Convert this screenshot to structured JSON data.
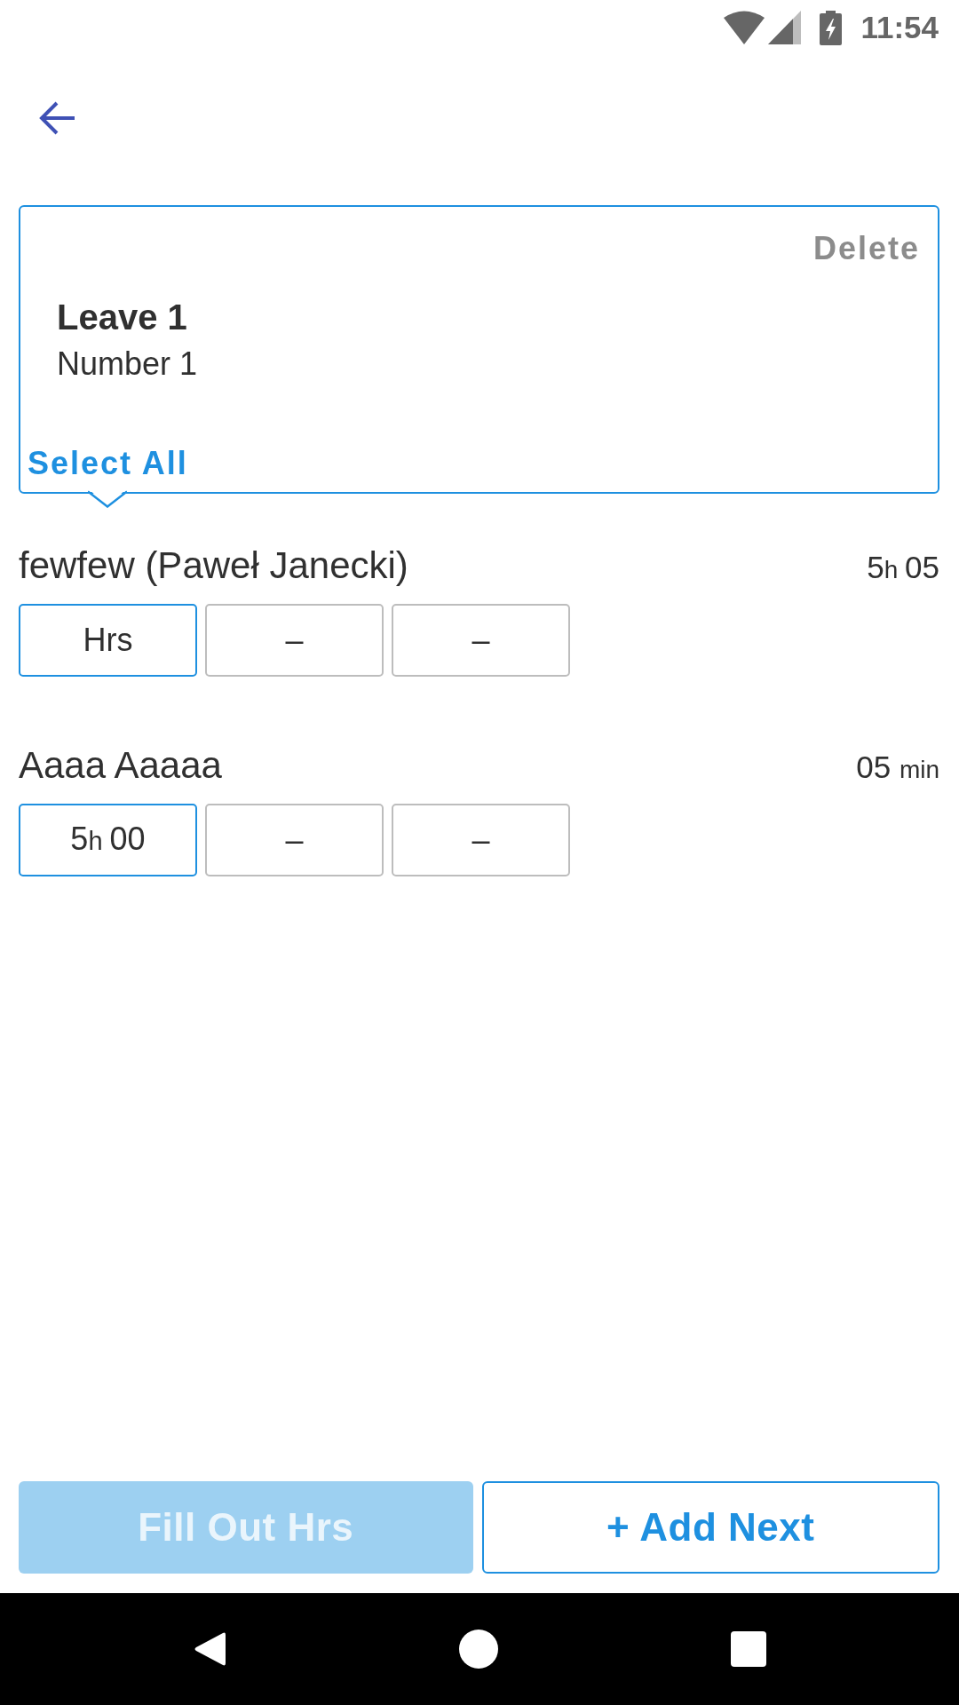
{
  "status_bar": {
    "time": "11:54"
  },
  "leave_card": {
    "delete_label": "Delete",
    "title": "Leave 1",
    "subtitle": "Number 1",
    "select_all_label": "Select All"
  },
  "people": [
    {
      "name": "fewfew (Paweł Janecki)",
      "total": [
        {
          "text": "5",
          "kind": "value"
        },
        {
          "text": "h ",
          "kind": "unit"
        },
        {
          "text": "05",
          "kind": "value"
        }
      ],
      "slots": [
        {
          "parts": [
            {
              "text": "Hrs",
              "kind": "value"
            }
          ],
          "selected": true
        },
        {
          "parts": [
            {
              "text": "–",
              "kind": "value"
            }
          ],
          "selected": false
        },
        {
          "parts": [
            {
              "text": "–",
              "kind": "value"
            }
          ],
          "selected": false
        }
      ]
    },
    {
      "name": "Aaaa Aaaaa",
      "total": [
        {
          "text": "05 ",
          "kind": "value"
        },
        {
          "text": "min",
          "kind": "unit"
        }
      ],
      "slots": [
        {
          "parts": [
            {
              "text": "5",
              "kind": "value"
            },
            {
              "text": "h ",
              "kind": "unit"
            },
            {
              "text": "00",
              "kind": "value"
            }
          ],
          "selected": true
        },
        {
          "parts": [
            {
              "text": "–",
              "kind": "value"
            }
          ],
          "selected": false
        },
        {
          "parts": [
            {
              "text": "–",
              "kind": "value"
            }
          ],
          "selected": false
        }
      ]
    }
  ],
  "buttons": [
    {
      "label": "Fill Out Hrs",
      "kind": "filled",
      "disabled": true
    },
    {
      "label": "+ Add Next",
      "kind": "outlined",
      "disabled": false
    }
  ]
}
